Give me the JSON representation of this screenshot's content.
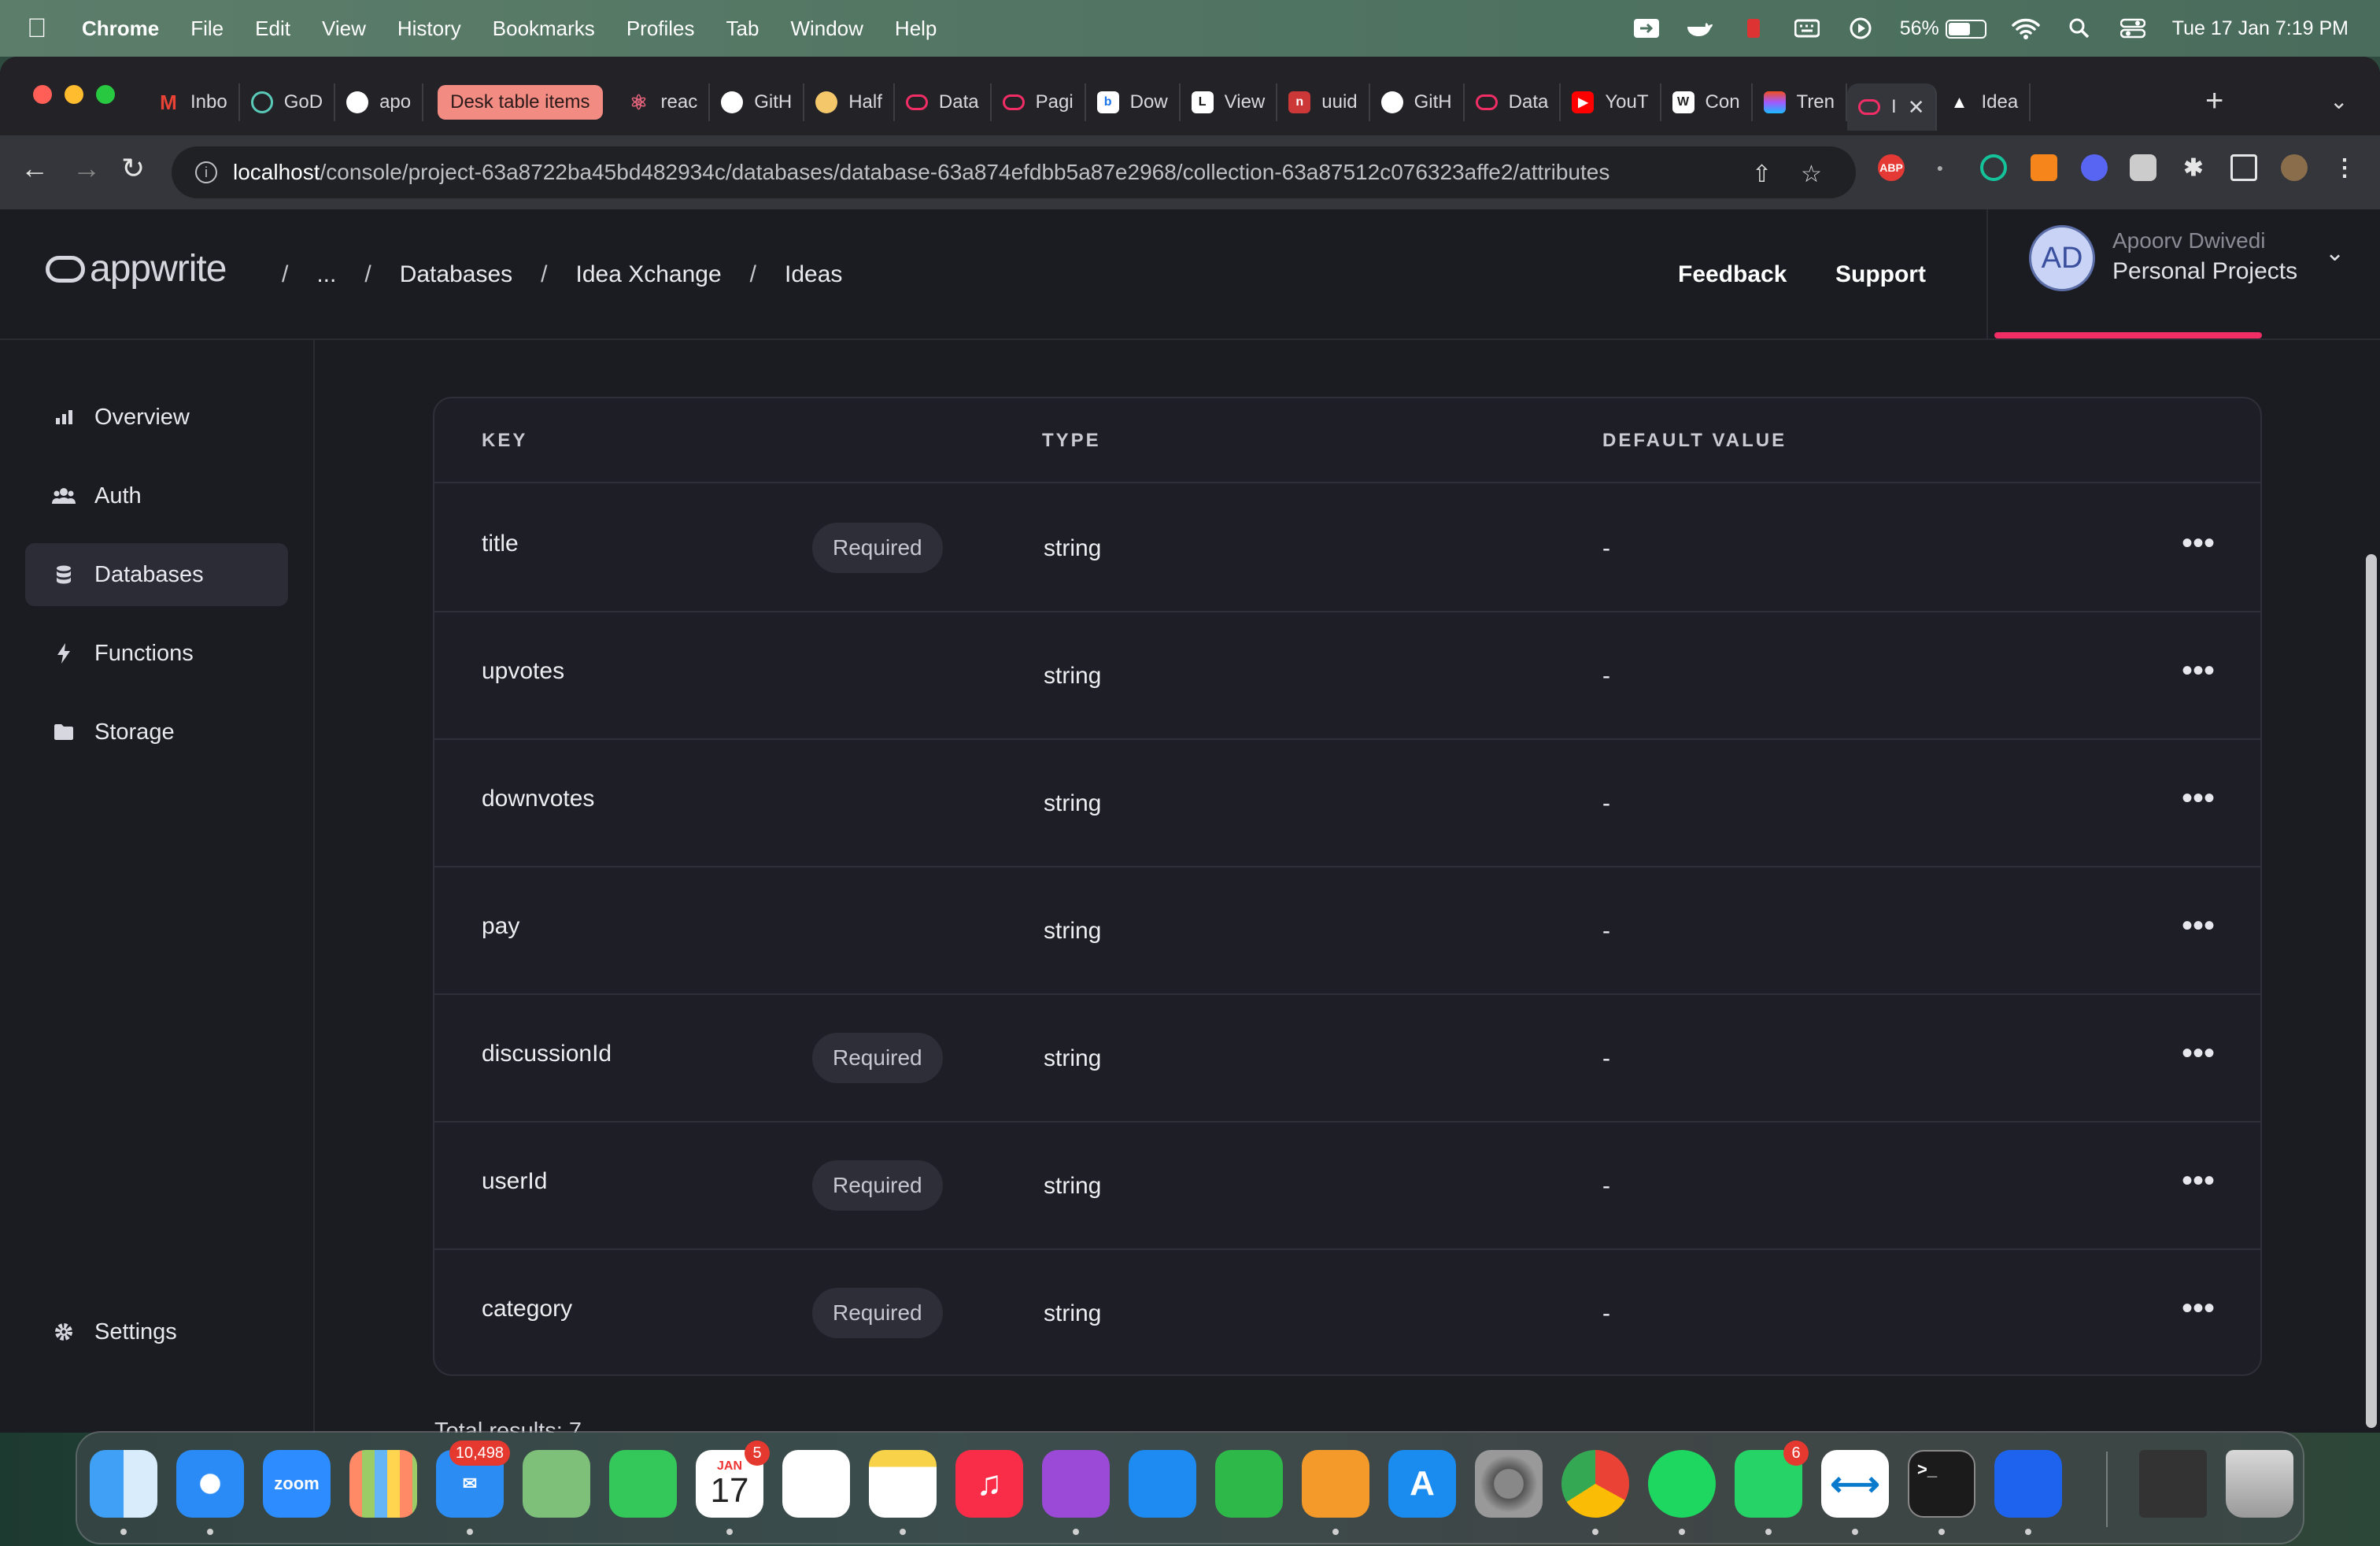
{
  "menubar": {
    "app_name": "Chrome",
    "items": [
      "File",
      "Edit",
      "View",
      "History",
      "Bookmarks",
      "Profiles",
      "Tab",
      "Window",
      "Help"
    ],
    "battery": "56%",
    "datetime": "Tue 17 Jan  7:19 PM"
  },
  "browser": {
    "tabs": [
      {
        "label": "Inbo",
        "icon": "gmail-icon"
      },
      {
        "label": "GoD",
        "icon": "loop-icon"
      },
      {
        "label": "apo",
        "icon": "github-icon"
      },
      {
        "label": "Desk table items",
        "icon": "tab-group"
      },
      {
        "label": "reac",
        "icon": "react-icon"
      },
      {
        "label": "GitH",
        "icon": "github-icon"
      },
      {
        "label": "Half",
        "icon": "bulb-icon"
      },
      {
        "label": "Data",
        "icon": "appwrite-icon"
      },
      {
        "label": "Pagi",
        "icon": "appwrite-icon"
      },
      {
        "label": "Dow",
        "icon": "b-icon"
      },
      {
        "label": "View",
        "icon": "l-icon"
      },
      {
        "label": "uuid",
        "icon": "npm-icon"
      },
      {
        "label": "GitH",
        "icon": "github-icon"
      },
      {
        "label": "Data",
        "icon": "appwrite-icon"
      },
      {
        "label": "YouT",
        "icon": "youtube-icon"
      },
      {
        "label": "Con",
        "icon": "w-icon"
      },
      {
        "label": "Tren",
        "icon": "figma-icon"
      },
      {
        "label": "I",
        "icon": "appwrite-icon"
      },
      {
        "label": "Idea",
        "icon": "vercel-icon"
      }
    ],
    "url_host": "localhost",
    "url_path": "/console/project-63a8722ba45bd482934c/databases/database-63a874efdbb5a87e2968/collection-63a87512c076323affe2/attributes"
  },
  "header": {
    "logo": "appwrite",
    "breadcrumbs": [
      "...",
      "Databases",
      "Idea Xchange",
      "Ideas"
    ],
    "feedback": "Feedback",
    "support": "Support",
    "account": {
      "initials": "AD",
      "name": "Apoorv Dwivedi",
      "org": "Personal Projects"
    },
    "accent": "#f02e65"
  },
  "sidebar": {
    "items": [
      {
        "label": "Overview",
        "icon": "chart-icon"
      },
      {
        "label": "Auth",
        "icon": "users-icon"
      },
      {
        "label": "Databases",
        "icon": "database-icon"
      },
      {
        "label": "Functions",
        "icon": "bolt-icon"
      },
      {
        "label": "Storage",
        "icon": "folder-icon"
      }
    ],
    "settings": "Settings",
    "active": "Databases"
  },
  "attributes": {
    "columns": [
      "KEY",
      "TYPE",
      "DEFAULT VALUE"
    ],
    "rows": [
      {
        "key": "title",
        "required": "Required",
        "type": "string",
        "default": "-"
      },
      {
        "key": "upvotes",
        "required": "",
        "type": "string",
        "default": "-"
      },
      {
        "key": "downvotes",
        "required": "",
        "type": "string",
        "default": "-"
      },
      {
        "key": "pay",
        "required": "",
        "type": "string",
        "default": "-"
      },
      {
        "key": "discussionId",
        "required": "Required",
        "type": "string",
        "default": "-"
      },
      {
        "key": "userId",
        "required": "Required",
        "type": "string",
        "default": "-"
      },
      {
        "key": "category",
        "required": "Required",
        "type": "string",
        "default": "-"
      }
    ],
    "total": "Total results: 7"
  },
  "dock": {
    "badges": {
      "mail": "10,498",
      "calendar": "5",
      "whatsapp": "6"
    },
    "calendar_month": "JAN",
    "calendar_day": "17",
    "zoom_label": "zoom"
  }
}
